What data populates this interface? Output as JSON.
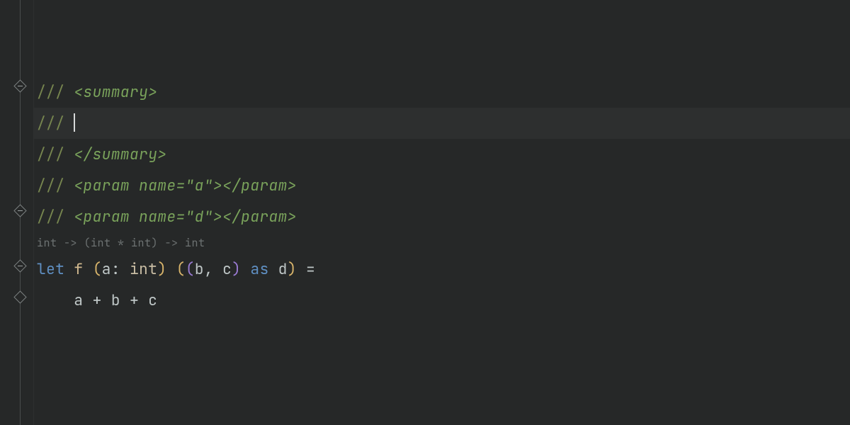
{
  "doc_comment": {
    "slashes": "///",
    "summary_open": "<summary>",
    "summary_close": "</summary>",
    "param_open": "<param",
    "param_close_tag": "</param>",
    "attr_name": "name=",
    "attr_val_a": "\"a\"",
    "attr_val_d": "\"d\"",
    "tag_close": ">"
  },
  "inlay": {
    "sig": "int -> (int * int) -> int"
  },
  "code": {
    "kw_let": "let",
    "kw_as": "as",
    "func": "f",
    "ident_a": "a",
    "ident_b": "b",
    "ident_c": "c",
    "ident_d": "d",
    "type_int": "int",
    "colon": ":",
    "comma": ",",
    "eq": "=",
    "plus": "+",
    "lp_a": "(",
    "rp_a": ")",
    "lp_b": "(",
    "rp_b": ")",
    "lp_b2": "(",
    "rp_b2": ")",
    "indent": "    "
  }
}
